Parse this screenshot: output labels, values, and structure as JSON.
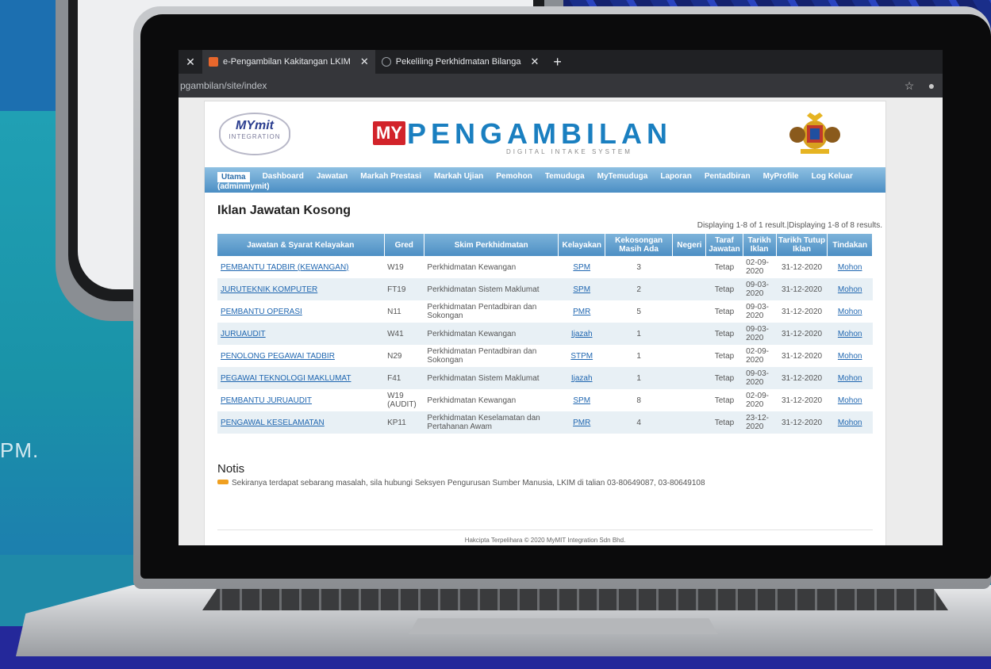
{
  "browser": {
    "tabs": [
      {
        "label": "e-Pengambilan Kakitangan LKIM"
      },
      {
        "label": "Pekeliling Perkhidmatan Bilanga"
      }
    ],
    "url": "pgambilan/site/index"
  },
  "background": {
    "side_text": "PM."
  },
  "header": {
    "mymit_logo": "MYmit",
    "mymit_sub": "INTEGRATION",
    "title_badge": "MY",
    "title": "PENGAMBILAN",
    "subtitle": "DIGITAL INTAKE SYSTEM"
  },
  "nav": {
    "items": [
      "Utama",
      "Dashboard",
      "Jawatan",
      "Markah Prestasi",
      "Markah Ujian",
      "Pemohon",
      "Temuduga",
      "MyTemuduga",
      "Laporan",
      "Pentadbiran",
      "MyProfile",
      "Log Keluar"
    ],
    "user": "(adminmymit)"
  },
  "main": {
    "title": "Iklan Jawatan Kosong",
    "summary": "Displaying 1-8 of 1 result.|Displaying 1-8 of 8 results.",
    "columns": [
      "Jawatan & Syarat Kelayakan",
      "Gred",
      "Skim Perkhidmatan",
      "Kelayakan",
      "Kekosongan Masih Ada",
      "Negeri",
      "Taraf Jawatan",
      "Tarikh Iklan",
      "Tarikh Tutup Iklan",
      "Tindakan"
    ],
    "rows": [
      {
        "jawatan": "PEMBANTU TADBIR (KEWANGAN)",
        "gred": "W19",
        "skim": "Perkhidmatan Kewangan",
        "kelayakan": "SPM",
        "kekosongan": "3",
        "negeri": "",
        "taraf": "Tetap",
        "tarikh_iklan": "02-09-2020",
        "tarikh_tutup": "31-12-2020",
        "tindakan": "Mohon"
      },
      {
        "jawatan": "JURUTEKNIK KOMPUTER",
        "gred": "FT19",
        "skim": "Perkhidmatan Sistem Maklumat",
        "kelayakan": "SPM",
        "kekosongan": "2",
        "negeri": "",
        "taraf": "Tetap",
        "tarikh_iklan": "09-03-2020",
        "tarikh_tutup": "31-12-2020",
        "tindakan": "Mohon"
      },
      {
        "jawatan": "PEMBANTU OPERASI",
        "gred": "N11",
        "skim": "Perkhidmatan Pentadbiran dan Sokongan",
        "kelayakan": "PMR",
        "kekosongan": "5",
        "negeri": "",
        "taraf": "Tetap",
        "tarikh_iklan": "09-03-2020",
        "tarikh_tutup": "31-12-2020",
        "tindakan": "Mohon"
      },
      {
        "jawatan": "JURUAUDIT",
        "gred": "W41",
        "skim": "Perkhidmatan Kewangan",
        "kelayakan": "Ijazah",
        "kekosongan": "1",
        "negeri": "",
        "taraf": "Tetap",
        "tarikh_iklan": "09-03-2020",
        "tarikh_tutup": "31-12-2020",
        "tindakan": "Mohon"
      },
      {
        "jawatan": "PENOLONG PEGAWAI TADBIR",
        "gred": "N29",
        "skim": "Perkhidmatan Pentadbiran dan Sokongan",
        "kelayakan": "STPM",
        "kekosongan": "1",
        "negeri": "",
        "taraf": "Tetap",
        "tarikh_iklan": "02-09-2020",
        "tarikh_tutup": "31-12-2020",
        "tindakan": "Mohon"
      },
      {
        "jawatan": "PEGAWAI TEKNOLOGI MAKLUMAT",
        "gred": "F41",
        "skim": "Perkhidmatan Sistem Maklumat",
        "kelayakan": "Ijazah",
        "kekosongan": "1",
        "negeri": "",
        "taraf": "Tetap",
        "tarikh_iklan": "09-03-2020",
        "tarikh_tutup": "31-12-2020",
        "tindakan": "Mohon"
      },
      {
        "jawatan": "PEMBANTU JURUAUDIT",
        "gred": "W19 (AUDIT)",
        "skim": "Perkhidmatan Kewangan",
        "kelayakan": "SPM",
        "kekosongan": "8",
        "negeri": "",
        "taraf": "Tetap",
        "tarikh_iklan": "02-09-2020",
        "tarikh_tutup": "31-12-2020",
        "tindakan": "Mohon"
      },
      {
        "jawatan": "PENGAWAL KESELAMATAN",
        "gred": "KP11",
        "skim": "Perkhidmatan Keselamatan dan Pertahanan Awam",
        "kelayakan": "PMR",
        "kekosongan": "4",
        "negeri": "",
        "taraf": "Tetap",
        "tarikh_iklan": "23-12-2020",
        "tarikh_tutup": "31-12-2020",
        "tindakan": "Mohon"
      }
    ]
  },
  "notis": {
    "title": "Notis",
    "text": "Sekiranya terdapat sebarang masalah, sila hubungi Seksyen Pengurusan Sumber Manusia, LKIM di talian 03-80649087, 03-80649108"
  },
  "footer": {
    "text": "Hakcipta Terpelihara © 2020 MyMIT Integration Sdn Bhd."
  }
}
